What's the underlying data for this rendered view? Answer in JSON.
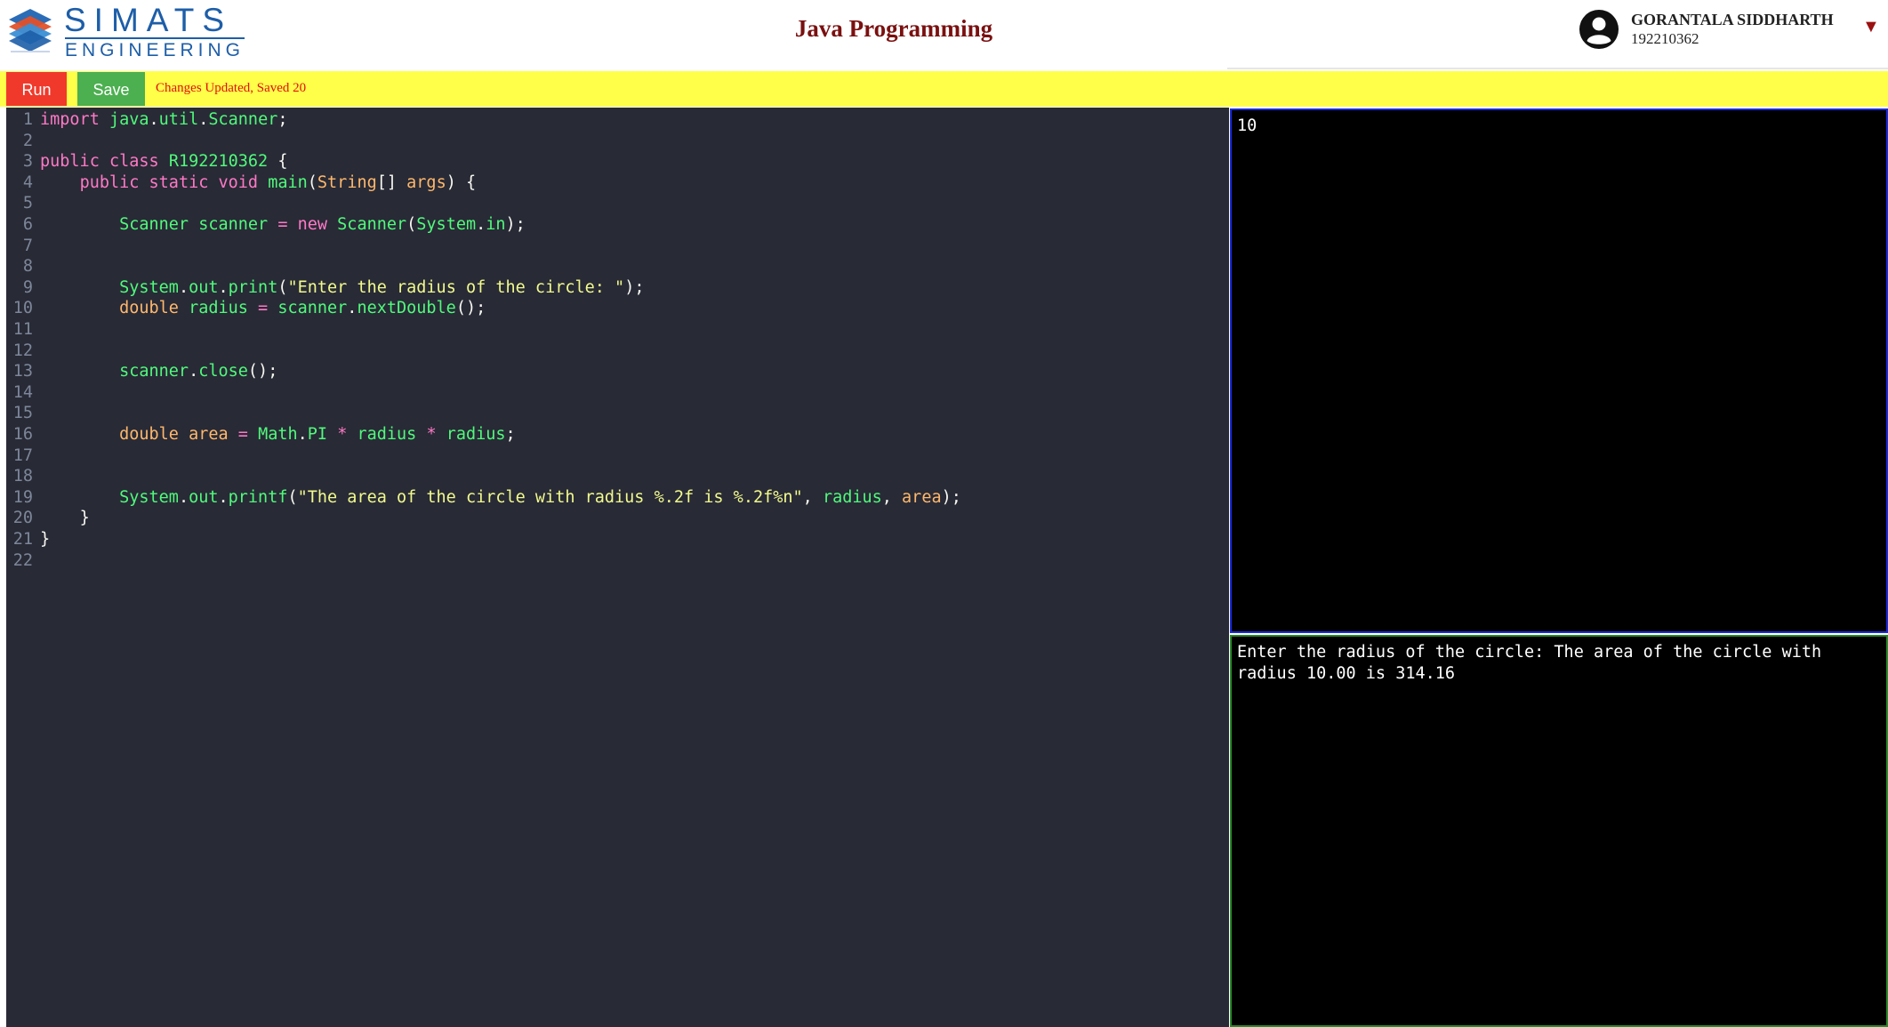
{
  "header": {
    "logo_text": "SIMATS",
    "logo_subtext": "ENGINEERING",
    "page_title": "Java Programming",
    "user_name": "GORANTALA SIDDHARTH",
    "user_id": "192210362",
    "caret_icon": "triangle-down-icon",
    "brand_color": "#1d5ea8",
    "title_color": "#7a1010"
  },
  "toolbar": {
    "run_label": "Run",
    "save_label": "Save",
    "status_text": "Changes Updated, Saved 20",
    "bg_color": "#ffff49",
    "run_color": "#f0392b",
    "save_color": "#4caf50"
  },
  "editor": {
    "bg_color": "#282a36",
    "lines": [
      {
        "n": "1",
        "text": "import java.util.Scanner;"
      },
      {
        "n": "2",
        "text": ""
      },
      {
        "n": "3",
        "text": "public class R192210362 {"
      },
      {
        "n": "4",
        "text": "    public static void main(String[] args) {"
      },
      {
        "n": "5",
        "text": ""
      },
      {
        "n": "6",
        "text": "        Scanner scanner = new Scanner(System.in);"
      },
      {
        "n": "7",
        "text": ""
      },
      {
        "n": "8",
        "text": ""
      },
      {
        "n": "9",
        "text": "        System.out.print(\"Enter the radius of the circle: \");"
      },
      {
        "n": "10",
        "text": "        double radius = scanner.nextDouble();"
      },
      {
        "n": "11",
        "text": ""
      },
      {
        "n": "12",
        "text": ""
      },
      {
        "n": "13",
        "text": "        scanner.close();"
      },
      {
        "n": "14",
        "text": ""
      },
      {
        "n": "15",
        "text": ""
      },
      {
        "n": "16",
        "text": "        double area = Math.PI * radius * radius;"
      },
      {
        "n": "17",
        "text": ""
      },
      {
        "n": "18",
        "text": ""
      },
      {
        "n": "19",
        "text": "        System.out.printf(\"The area of the circle with radius %.2f is %.2f%n\", radius, area);"
      },
      {
        "n": "20",
        "text": "    }"
      },
      {
        "n": "21",
        "text": "}"
      },
      {
        "n": "22",
        "text": ""
      }
    ]
  },
  "input_panel": {
    "value": "10",
    "border_color": "#1a2bd8"
  },
  "output_panel": {
    "value": "Enter the radius of the circle: The area of the circle with radius 10.00 is 314.16",
    "border_color": "#2a8a2a"
  }
}
